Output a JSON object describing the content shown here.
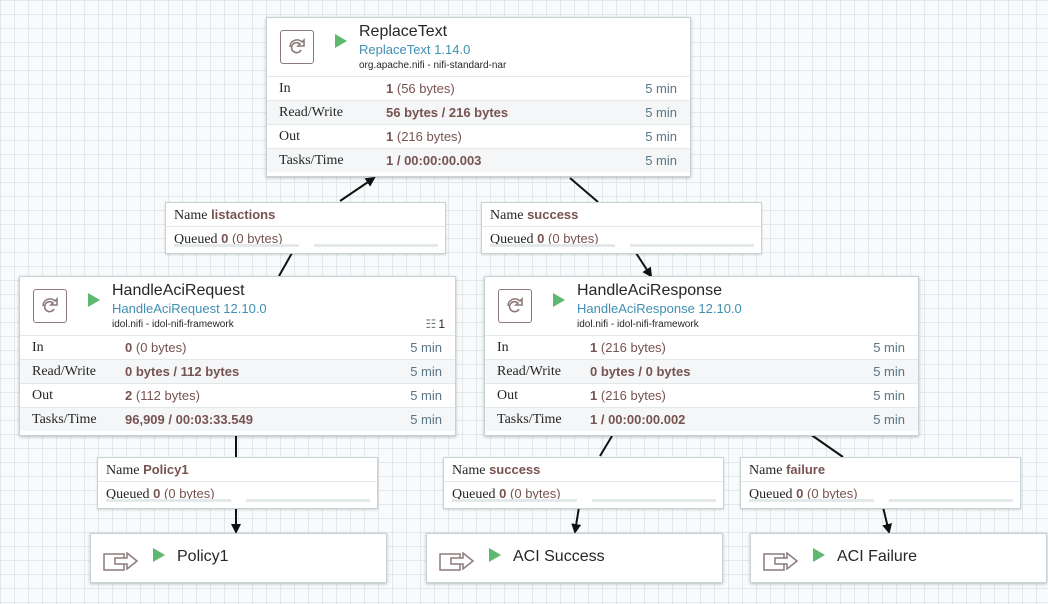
{
  "processors": [
    {
      "id": "replacetext",
      "name": "ReplaceText",
      "type": "ReplaceText 1.14.0",
      "bundle": "org.apache.nifi - nifi-standard-nar",
      "badge_count": "",
      "stats": {
        "in_label": "In",
        "in_count": "1",
        "in_bytes": "(56 bytes)",
        "in_time": "5 min",
        "rw_label": "Read/Write",
        "rw_value": "56 bytes / 216 bytes",
        "rw_time": "5 min",
        "out_label": "Out",
        "out_count": "1",
        "out_bytes": "(216 bytes)",
        "out_time": "5 min",
        "tasks_label": "Tasks/Time",
        "tasks_value": "1 / 00:00:00.003",
        "tasks_time": "5 min"
      }
    },
    {
      "id": "handleacirequest",
      "name": "HandleAciRequest",
      "type": "HandleAciRequest 12.10.0",
      "bundle": "idol.nifi - idol-nifi-framework",
      "badge_count": "1",
      "stats": {
        "in_label": "In",
        "in_count": "0",
        "in_bytes": "(0 bytes)",
        "in_time": "5 min",
        "rw_label": "Read/Write",
        "rw_value": "0 bytes / 112 bytes",
        "rw_time": "5 min",
        "out_label": "Out",
        "out_count": "2",
        "out_bytes": "(112 bytes)",
        "out_time": "5 min",
        "tasks_label": "Tasks/Time",
        "tasks_value": "96,909 / 00:03:33.549",
        "tasks_time": "5 min"
      }
    },
    {
      "id": "handleaciresponse",
      "name": "HandleAciResponse",
      "type": "HandleAciResponse 12.10.0",
      "bundle": "idol.nifi - idol-nifi-framework",
      "badge_count": "",
      "stats": {
        "in_label": "In",
        "in_count": "1",
        "in_bytes": "(216 bytes)",
        "in_time": "5 min",
        "rw_label": "Read/Write",
        "rw_value": "0 bytes / 0 bytes",
        "rw_time": "5 min",
        "out_label": "Out",
        "out_count": "1",
        "out_bytes": "(216 bytes)",
        "out_time": "5 min",
        "tasks_label": "Tasks/Time",
        "tasks_value": "1 / 00:00:00.002",
        "tasks_time": "5 min"
      }
    }
  ],
  "connections": [
    {
      "id": "listactions",
      "name_key": "Name",
      "name": "listactions",
      "queued_key": "Queued",
      "queued_count": "0",
      "queued_bytes": "(0 bytes)"
    },
    {
      "id": "success-top",
      "name_key": "Name",
      "name": "success",
      "queued_key": "Queued",
      "queued_count": "0",
      "queued_bytes": "(0 bytes)"
    },
    {
      "id": "policy1",
      "name_key": "Name",
      "name": "Policy1",
      "queued_key": "Queued",
      "queued_count": "0",
      "queued_bytes": "(0 bytes)"
    },
    {
      "id": "success-bottom",
      "name_key": "Name",
      "name": "success",
      "queued_key": "Queued",
      "queued_count": "0",
      "queued_bytes": "(0 bytes)"
    },
    {
      "id": "failure",
      "name_key": "Name",
      "name": "failure",
      "queued_key": "Queued",
      "queued_count": "0",
      "queued_bytes": "(0 bytes)"
    }
  ],
  "ports": [
    {
      "id": "policy1-port",
      "name": "Policy1"
    },
    {
      "id": "aci-success-port",
      "name": "ACI Success"
    },
    {
      "id": "aci-failure-port",
      "name": "ACI Failure"
    }
  ],
  "colors": {
    "running": "#5fb870",
    "type_text": "#3f8fb3",
    "value_text": "#775351",
    "edge": "#111111",
    "canvas": "#f9fafb",
    "grid": "#e3e8eb"
  },
  "icons": {
    "processor": "processor-icon",
    "running": "play-icon",
    "output_port": "output-port-icon",
    "cluster": "cluster-icon"
  }
}
